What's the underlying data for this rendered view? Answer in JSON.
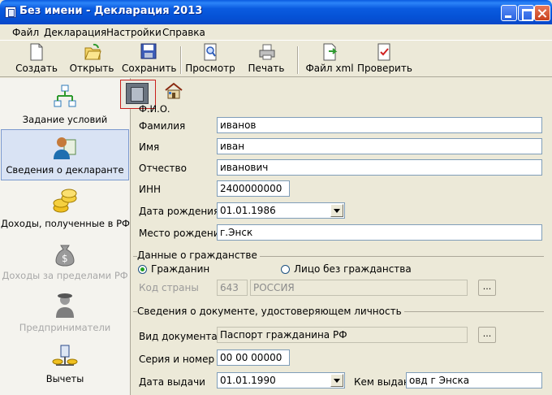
{
  "window": {
    "title": "Без имени - Декларация 2013"
  },
  "menu": [
    "Файл",
    "Декларация",
    "Настройки",
    "Справка"
  ],
  "toolbar": {
    "create": "Создать",
    "open": "Открыть",
    "save": "Сохранить",
    "preview": "Просмотр",
    "print": "Печать",
    "xml": "Файл xml",
    "check": "Проверить"
  },
  "nav": [
    {
      "label": "Задание условий"
    },
    {
      "label": "Сведения о декларанте"
    },
    {
      "label": "Доходы, полученные в РФ"
    },
    {
      "label": "Доходы за пределами РФ"
    },
    {
      "label": "Предприниматели"
    },
    {
      "label": "Вычеты"
    }
  ],
  "tabs": {
    "fio_label": "Ф.И.О."
  },
  "person": {
    "surname_label": "Фамилия",
    "surname": "иванов",
    "name_label": "Имя",
    "name": "иван",
    "patronymic_label": "Отчество",
    "patronymic": "иванович",
    "inn_label": "ИНН",
    "inn": "2400000000",
    "birthdate_label": "Дата рождения",
    "birthdate": "01.01.1986",
    "birthplace_label": "Место рождения",
    "birthplace": "г.Энск"
  },
  "citizenship": {
    "title": "Данные о гражданстве",
    "citizen": "Гражданин",
    "stateless": "Лицо без гражданства",
    "country_code_label": "Код страны",
    "country_code": "643",
    "country_name": "РОССИЯ",
    "browse": "..."
  },
  "document": {
    "title": "Сведения о документе, удостоверяющем личность",
    "type_label": "Вид документа",
    "type": "Паспорт гражданина РФ",
    "browse": "...",
    "series_label": "Серия и номер",
    "series": "00 00 00000",
    "issue_date_label": "Дата выдачи",
    "issue_date": "01.01.1990",
    "issued_by_label": "Кем выдан",
    "issued_by": "овд г Энска"
  }
}
